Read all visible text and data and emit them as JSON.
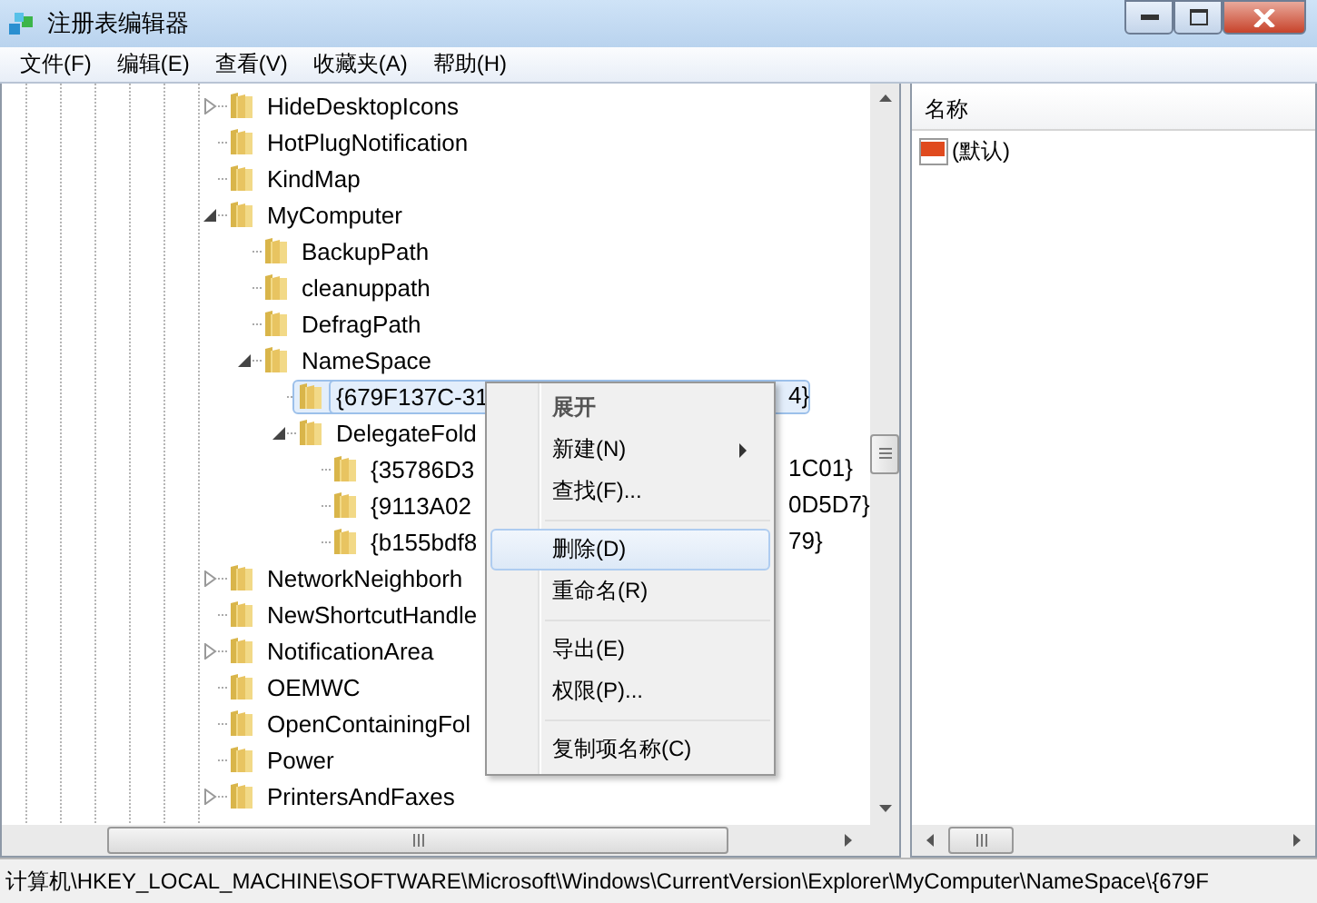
{
  "window": {
    "title": "注册表编辑器"
  },
  "menu": [
    "文件(F)",
    "编辑(E)",
    "查看(V)",
    "收藏夹(A)",
    "帮助(H)"
  ],
  "tree": [
    {
      "label": "HideDesktopIcons",
      "expanded": false,
      "selected": false
    },
    {
      "label": "HotPlugNotification",
      "selected": false
    },
    {
      "label": "KindMap",
      "selected": false
    },
    {
      "label": "MyComputer",
      "expanded": true,
      "selected": false,
      "children": [
        {
          "label": "BackupPath",
          "selected": false
        },
        {
          "label": "cleanuppath",
          "selected": false
        },
        {
          "label": "DefragPath",
          "selected": false
        },
        {
          "label": "NameSpace",
          "expanded": true,
          "selected": false,
          "children": [
            {
              "label": "{679F137C-31",
              "tail": "4}",
              "selected": true
            },
            {
              "label": "DelegateFold",
              "expanded": true,
              "selected": false,
              "children": [
                {
                  "label": "{35786D3",
                  "tail": "1C01}",
                  "selected": false
                },
                {
                  "label": "{9113A02",
                  "tail": "0D5D7}",
                  "selected": false
                },
                {
                  "label": "{b155bdf8",
                  "tail": "79}",
                  "selected": false
                }
              ]
            }
          ]
        }
      ]
    },
    {
      "label": "NetworkNeighborh",
      "expanded": false,
      "selected": false
    },
    {
      "label": "NewShortcutHandle",
      "selected": false
    },
    {
      "label": "NotificationArea",
      "expanded": false,
      "selected": false
    },
    {
      "label": "OEMWC",
      "selected": false
    },
    {
      "label": "OpenContainingFol",
      "selected": false
    },
    {
      "label": "Power",
      "selected": false
    },
    {
      "label": "PrintersAndFaxes",
      "expanded": false,
      "selected": false
    }
  ],
  "context_menu": [
    {
      "kind": "item",
      "label": "展开",
      "bold": true,
      "selected": false
    },
    {
      "kind": "submenu",
      "label": "新建(N)",
      "selected": false
    },
    {
      "kind": "item",
      "label": "查找(F)...",
      "selected": false
    },
    {
      "kind": "separator"
    },
    {
      "kind": "item",
      "label": "删除(D)",
      "selected": true
    },
    {
      "kind": "item",
      "label": "重命名(R)",
      "selected": false
    },
    {
      "kind": "separator"
    },
    {
      "kind": "item",
      "label": "导出(E)",
      "selected": false
    },
    {
      "kind": "item",
      "label": "权限(P)...",
      "selected": false
    },
    {
      "kind": "separator"
    },
    {
      "kind": "item",
      "label": "复制项名称(C)",
      "selected": false
    }
  ],
  "values": {
    "columns": [
      "名称"
    ],
    "rows": [
      {
        "name": "(默认)"
      }
    ]
  },
  "status_bar": "计算机\\HKEY_LOCAL_MACHINE\\SOFTWARE\\Microsoft\\Windows\\CurrentVersion\\Explorer\\MyComputer\\NameSpace\\{679F"
}
